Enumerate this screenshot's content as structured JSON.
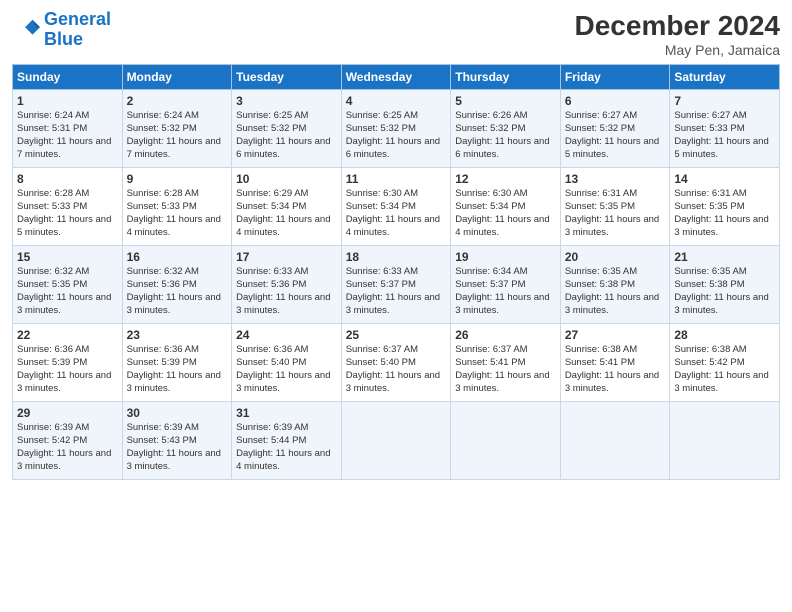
{
  "header": {
    "logo_line1": "General",
    "logo_line2": "Blue",
    "month": "December 2024",
    "location": "May Pen, Jamaica"
  },
  "days_of_week": [
    "Sunday",
    "Monday",
    "Tuesday",
    "Wednesday",
    "Thursday",
    "Friday",
    "Saturday"
  ],
  "weeks": [
    [
      {
        "day": 1,
        "sunrise": "6:24 AM",
        "sunset": "5:31 PM",
        "daylight": "11 hours and 7 minutes."
      },
      {
        "day": 2,
        "sunrise": "6:24 AM",
        "sunset": "5:32 PM",
        "daylight": "11 hours and 7 minutes."
      },
      {
        "day": 3,
        "sunrise": "6:25 AM",
        "sunset": "5:32 PM",
        "daylight": "11 hours and 6 minutes."
      },
      {
        "day": 4,
        "sunrise": "6:25 AM",
        "sunset": "5:32 PM",
        "daylight": "11 hours and 6 minutes."
      },
      {
        "day": 5,
        "sunrise": "6:26 AM",
        "sunset": "5:32 PM",
        "daylight": "11 hours and 6 minutes."
      },
      {
        "day": 6,
        "sunrise": "6:27 AM",
        "sunset": "5:32 PM",
        "daylight": "11 hours and 5 minutes."
      },
      {
        "day": 7,
        "sunrise": "6:27 AM",
        "sunset": "5:33 PM",
        "daylight": "11 hours and 5 minutes."
      }
    ],
    [
      {
        "day": 8,
        "sunrise": "6:28 AM",
        "sunset": "5:33 PM",
        "daylight": "11 hours and 5 minutes."
      },
      {
        "day": 9,
        "sunrise": "6:28 AM",
        "sunset": "5:33 PM",
        "daylight": "11 hours and 4 minutes."
      },
      {
        "day": 10,
        "sunrise": "6:29 AM",
        "sunset": "5:34 PM",
        "daylight": "11 hours and 4 minutes."
      },
      {
        "day": 11,
        "sunrise": "6:30 AM",
        "sunset": "5:34 PM",
        "daylight": "11 hours and 4 minutes."
      },
      {
        "day": 12,
        "sunrise": "6:30 AM",
        "sunset": "5:34 PM",
        "daylight": "11 hours and 4 minutes."
      },
      {
        "day": 13,
        "sunrise": "6:31 AM",
        "sunset": "5:35 PM",
        "daylight": "11 hours and 3 minutes."
      },
      {
        "day": 14,
        "sunrise": "6:31 AM",
        "sunset": "5:35 PM",
        "daylight": "11 hours and 3 minutes."
      }
    ],
    [
      {
        "day": 15,
        "sunrise": "6:32 AM",
        "sunset": "5:35 PM",
        "daylight": "11 hours and 3 minutes."
      },
      {
        "day": 16,
        "sunrise": "6:32 AM",
        "sunset": "5:36 PM",
        "daylight": "11 hours and 3 minutes."
      },
      {
        "day": 17,
        "sunrise": "6:33 AM",
        "sunset": "5:36 PM",
        "daylight": "11 hours and 3 minutes."
      },
      {
        "day": 18,
        "sunrise": "6:33 AM",
        "sunset": "5:37 PM",
        "daylight": "11 hours and 3 minutes."
      },
      {
        "day": 19,
        "sunrise": "6:34 AM",
        "sunset": "5:37 PM",
        "daylight": "11 hours and 3 minutes."
      },
      {
        "day": 20,
        "sunrise": "6:35 AM",
        "sunset": "5:38 PM",
        "daylight": "11 hours and 3 minutes."
      },
      {
        "day": 21,
        "sunrise": "6:35 AM",
        "sunset": "5:38 PM",
        "daylight": "11 hours and 3 minutes."
      }
    ],
    [
      {
        "day": 22,
        "sunrise": "6:36 AM",
        "sunset": "5:39 PM",
        "daylight": "11 hours and 3 minutes."
      },
      {
        "day": 23,
        "sunrise": "6:36 AM",
        "sunset": "5:39 PM",
        "daylight": "11 hours and 3 minutes."
      },
      {
        "day": 24,
        "sunrise": "6:36 AM",
        "sunset": "5:40 PM",
        "daylight": "11 hours and 3 minutes."
      },
      {
        "day": 25,
        "sunrise": "6:37 AM",
        "sunset": "5:40 PM",
        "daylight": "11 hours and 3 minutes."
      },
      {
        "day": 26,
        "sunrise": "6:37 AM",
        "sunset": "5:41 PM",
        "daylight": "11 hours and 3 minutes."
      },
      {
        "day": 27,
        "sunrise": "6:38 AM",
        "sunset": "5:41 PM",
        "daylight": "11 hours and 3 minutes."
      },
      {
        "day": 28,
        "sunrise": "6:38 AM",
        "sunset": "5:42 PM",
        "daylight": "11 hours and 3 minutes."
      }
    ],
    [
      {
        "day": 29,
        "sunrise": "6:39 AM",
        "sunset": "5:42 PM",
        "daylight": "11 hours and 3 minutes."
      },
      {
        "day": 30,
        "sunrise": "6:39 AM",
        "sunset": "5:43 PM",
        "daylight": "11 hours and 3 minutes."
      },
      {
        "day": 31,
        "sunrise": "6:39 AM",
        "sunset": "5:44 PM",
        "daylight": "11 hours and 4 minutes."
      },
      null,
      null,
      null,
      null
    ]
  ]
}
